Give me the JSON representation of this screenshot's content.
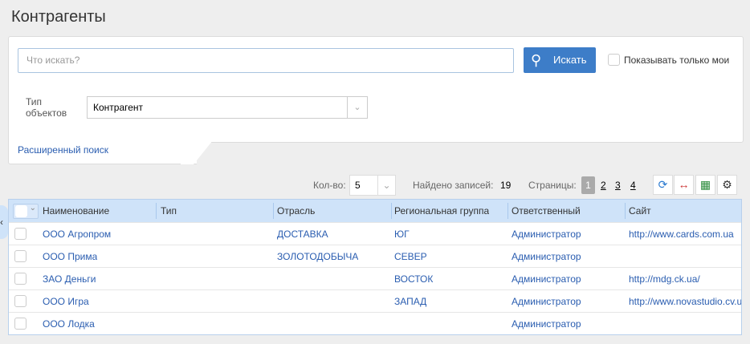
{
  "title": "Контрагенты",
  "search": {
    "placeholder": "Что искать?",
    "button": "Искать",
    "only_mine": "Показывать только мои"
  },
  "filter": {
    "label_line1": "Тип",
    "label_line2": "объектов",
    "value": "Контрагент"
  },
  "advanced_search": "Расширенный поиск",
  "toolbar": {
    "count_label": "Кол-во:",
    "count_value": "5",
    "found_label": "Найдено записей:",
    "found_value": "19",
    "pages_label": "Страницы:",
    "pages": [
      "1",
      "2",
      "3",
      "4"
    ],
    "current_page": "1"
  },
  "columns": [
    "Наименование",
    "Тип",
    "Отрасль",
    "Региональная группа",
    "Ответственный",
    "Сайт"
  ],
  "rows": [
    {
      "name": "ООО Агропром",
      "type": "",
      "industry": "ДОСТАВКА",
      "region": "ЮГ",
      "owner": "Администратор",
      "site": "http://www.cards.com.ua"
    },
    {
      "name": "ООО Прима",
      "type": "",
      "industry": "ЗОЛОТОДОБЫЧА",
      "region": "СЕВЕР",
      "owner": "Администратор",
      "site": ""
    },
    {
      "name": "ЗАО Деньги",
      "type": "",
      "industry": "",
      "region": "ВОСТОК",
      "owner": "Администратор",
      "site": "http://mdg.ck.ua/"
    },
    {
      "name": "ООО Игра",
      "type": "",
      "industry": "",
      "region": "ЗАПАД",
      "owner": "Администратор",
      "site": "http://www.novastudio.cv.ua"
    },
    {
      "name": "ООО Лодка",
      "type": "",
      "industry": "",
      "region": "",
      "owner": "Администратор",
      "site": ""
    }
  ],
  "colors": {
    "accent": "#3d7dc8",
    "header_bg": "#cfe3f9",
    "link": "#2a5db0"
  }
}
